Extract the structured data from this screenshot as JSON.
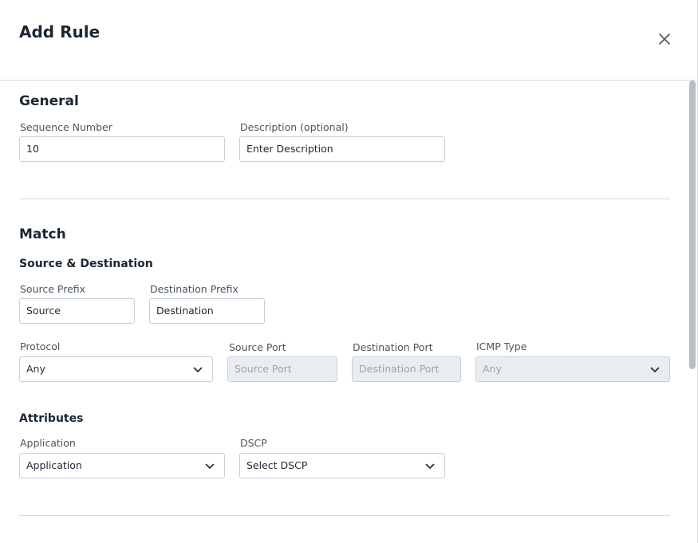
{
  "header": {
    "title": "Add Rule"
  },
  "general": {
    "title": "General",
    "sequence_number": {
      "label": "Sequence Number",
      "value": "10"
    },
    "description": {
      "label": "Description (optional)",
      "placeholder": "Enter Description"
    }
  },
  "match": {
    "title": "Match",
    "source_destination": {
      "title": "Source & Destination",
      "source_prefix": {
        "label": "Source Prefix",
        "placeholder": "Source"
      },
      "destination_prefix": {
        "label": "Destination Prefix",
        "placeholder": "Destination"
      },
      "protocol": {
        "label": "Protocol",
        "value": "Any"
      },
      "source_port": {
        "label": "Source Port",
        "placeholder": "Source Port"
      },
      "destination_port": {
        "label": "Destination Port",
        "placeholder": "Destination Port"
      },
      "icmp_type": {
        "label": "ICMP Type",
        "value": "Any"
      }
    },
    "attributes": {
      "title": "Attributes",
      "application": {
        "label": "Application",
        "value": "Application"
      },
      "dscp": {
        "label": "DSCP",
        "value": "Select DSCP"
      }
    }
  },
  "icons": {
    "close": "close-icon",
    "chevron": "chevron-down-icon"
  },
  "colors": {
    "border": "#c9cfd5",
    "disabled_bg": "#e9edf1",
    "heading": "#1b2733",
    "label": "#4a5561"
  }
}
